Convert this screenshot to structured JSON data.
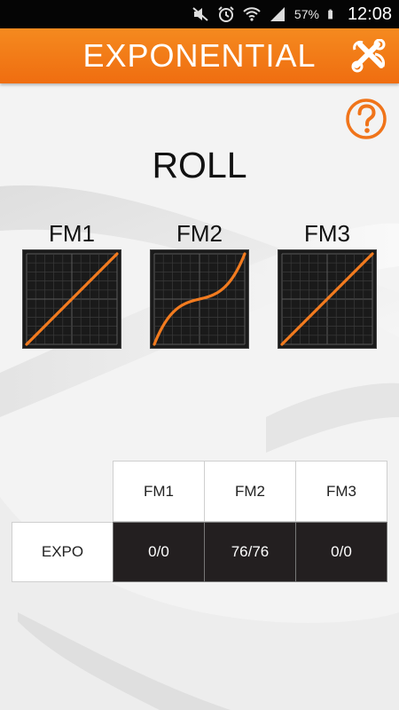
{
  "status_bar": {
    "battery_percent": "57%",
    "time": "12:08",
    "icons": [
      "mute-icon",
      "alarm-icon",
      "wifi-icon",
      "signal-icon",
      "battery-icon"
    ]
  },
  "header": {
    "title": "EXPONENTIAL",
    "settings_icon": "wrench-cross-icon",
    "color": "#f0741a"
  },
  "help": {
    "icon": "help-question-icon",
    "color": "#f0741a"
  },
  "axis_title": "ROLL",
  "curves": [
    {
      "label": "FM1",
      "expo": 0
    },
    {
      "label": "FM2",
      "expo": 76
    },
    {
      "label": "FM3",
      "expo": 0
    }
  ],
  "table": {
    "columns": [
      "FM1",
      "FM2",
      "FM3"
    ],
    "rows": [
      {
        "label": "EXPO",
        "values": [
          "0/0",
          "76/76",
          "0/0"
        ]
      }
    ]
  },
  "colors": {
    "accent": "#f0741a",
    "curve": "#f27b1f",
    "graph_bg": "#1a1a1a",
    "value_cell": "#231f20"
  }
}
